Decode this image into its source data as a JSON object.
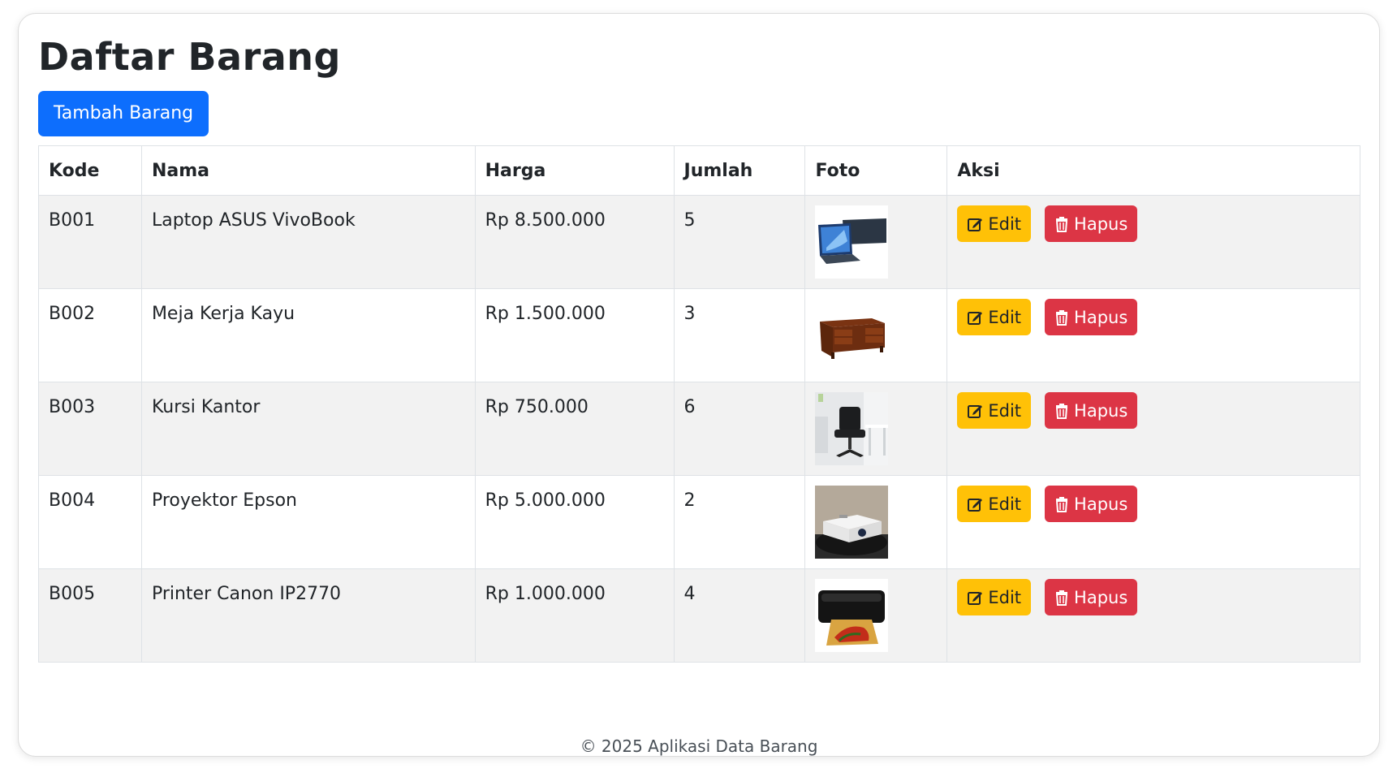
{
  "page": {
    "title": "Daftar Barang",
    "add_button": "Tambah Barang",
    "footer": "© 2025 Aplikasi Data Barang"
  },
  "table": {
    "headers": [
      "Kode",
      "Nama",
      "Harga",
      "Jumlah",
      "Foto",
      "Aksi"
    ],
    "rows": [
      {
        "kode": "B001",
        "nama": "Laptop ASUS VivoBook",
        "harga": "Rp 8.500.000",
        "jumlah": "5",
        "foto": "laptop-photo"
      },
      {
        "kode": "B002",
        "nama": "Meja Kerja Kayu",
        "harga": "Rp 1.500.000",
        "jumlah": "3",
        "foto": "desk-photo"
      },
      {
        "kode": "B003",
        "nama": "Kursi Kantor",
        "harga": "Rp 750.000",
        "jumlah": "6",
        "foto": "chair-photo"
      },
      {
        "kode": "B004",
        "nama": "Proyektor Epson",
        "harga": "Rp 5.000.000",
        "jumlah": "2",
        "foto": "projector-photo"
      },
      {
        "kode": "B005",
        "nama": "Printer Canon IP2770",
        "harga": "Rp 1.000.000",
        "jumlah": "4",
        "foto": "printer-photo"
      }
    ],
    "actions": {
      "edit": "Edit",
      "delete": "Hapus"
    }
  },
  "colors": {
    "primary": "#0d6efd",
    "warning": "#ffc107",
    "danger": "#dc3545"
  },
  "icons": {
    "edit": "pencil-square-icon",
    "delete": "trash-icon"
  }
}
